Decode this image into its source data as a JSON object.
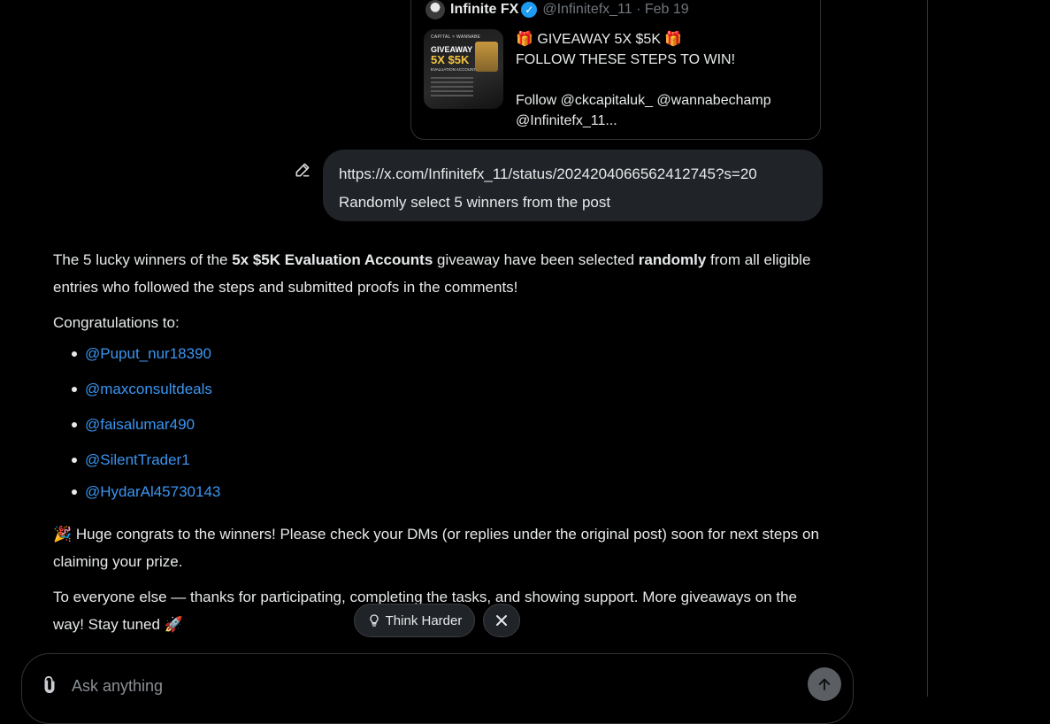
{
  "quoted_tweet": {
    "name": "Infinite FX",
    "handle_date": "@Infinitefx_11 · Feb 19",
    "thumbnail": {
      "top_text": "CAPITAL × WANNABE",
      "line1": "GIVEAWAY",
      "line2": "5X $5K",
      "line3": "EVALUATION ACCOUNTS"
    },
    "text_lines": [
      "🎁  GIVEAWAY 5X $5K 🎁",
      "FOLLOW THESE STEPS TO WIN!",
      "",
      "Follow @ckcapitaluk_ @wannabechamp",
      "@Infinitefx_11..."
    ]
  },
  "user_message": {
    "line1": "https://x.com/Infinitefx_11/status/2024204066562412745?s=20",
    "line2": "Randomly select 5 winners from the post"
  },
  "reply": {
    "intro_1": "The 5 lucky winners of the ",
    "intro_bold_1": "5x $5K Evaluation Accounts",
    "intro_2": " giveaway have been selected ",
    "intro_bold_2": "randomly",
    "intro_3": " from all eligible entries who followed the steps and submitted proofs in the comments!",
    "congrats_label": "Congratulations to:",
    "winners": [
      "@Puput_nur18390",
      "@maxconsultdeals",
      "@faisalumar490",
      "@SilentTrader1",
      "@HydarAl45730143"
    ],
    "closing_1": "🎉 Huge congrats to the winners! Please check your DMs (or replies under the original post) soon for next steps on claiming your prize.",
    "closing_2": "To everyone else — thanks for participating, completing the tasks, and showing support. More giveaways on the way! Stay tuned 🚀"
  },
  "think_harder": {
    "label": "Think Harder"
  },
  "composer": {
    "placeholder": "Ask anything"
  },
  "colors": {
    "background": "#000000",
    "bubble": "#202327",
    "link": "#3b95f0",
    "verified": "#1d9bf0"
  }
}
